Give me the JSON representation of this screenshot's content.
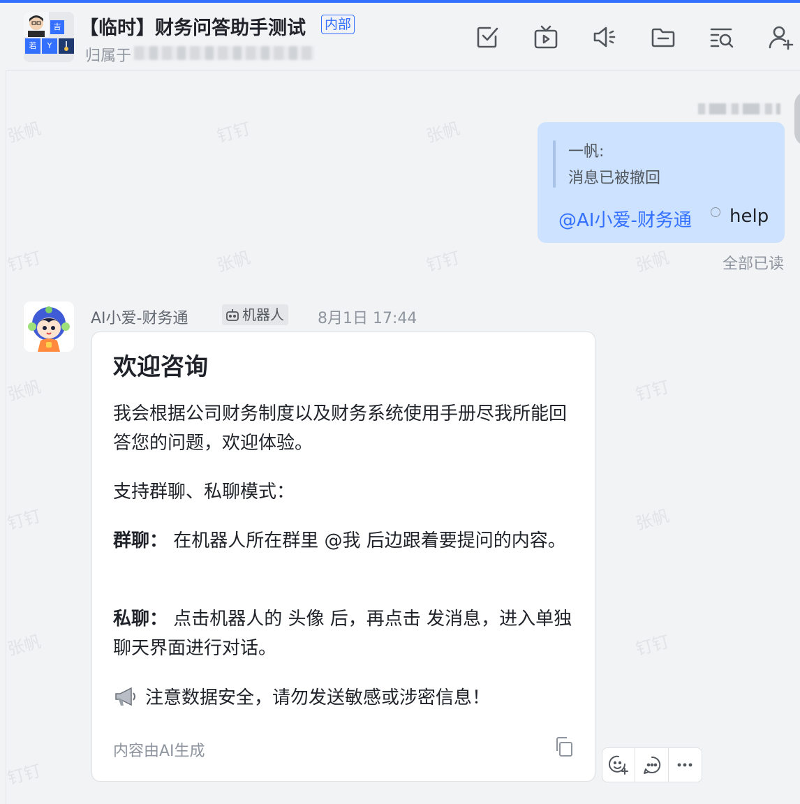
{
  "header": {
    "title": "【临时】财务问答助手测试",
    "badge": "内部",
    "owner_label": "归属于",
    "avatar_cells": [
      "吉",
      "若",
      "Y"
    ],
    "icons": [
      "task-check-icon",
      "live-tv-icon",
      "announcement-icon",
      "folder-icon",
      "search-history-icon",
      "add-member-icon"
    ]
  },
  "watermark": {
    "texts": [
      "张帆",
      "钉钉"
    ]
  },
  "my_message": {
    "quote_author": "一帆:",
    "quote_text": "消息已被撤回",
    "mention": "@AI小爱-财务通",
    "text": "help",
    "read_status": "全部已读"
  },
  "bot_message": {
    "sender": "AI小爱-财务通",
    "tag": "机器人",
    "time": "8月1日 17:44",
    "card": {
      "title": "欢迎咨询",
      "intro": "我会根据公司财务制度以及财务系统使用手册尽我所能回答您的问题，欢迎体验。",
      "modes_intro": "支持群聊、私聊模式：",
      "group_label": "群聊：",
      "group_text": "在机器人所在群里 @我 后边跟着要提问的内容。",
      "private_label": "私聊：",
      "private_text": "点击机器人的 头像 后，再点击 发消息，进入单独聊天界面进行对话。",
      "security_note": "注意数据安全，请勿发送敏感或涉密信息！",
      "ai_note": "内容由AI生成"
    },
    "actions": [
      "add-reaction-icon",
      "reply-icon",
      "more-icon"
    ]
  },
  "colors": {
    "accent": "#3370ff",
    "my_bubble": "#cce2fe",
    "background": "#f2f3f5"
  }
}
